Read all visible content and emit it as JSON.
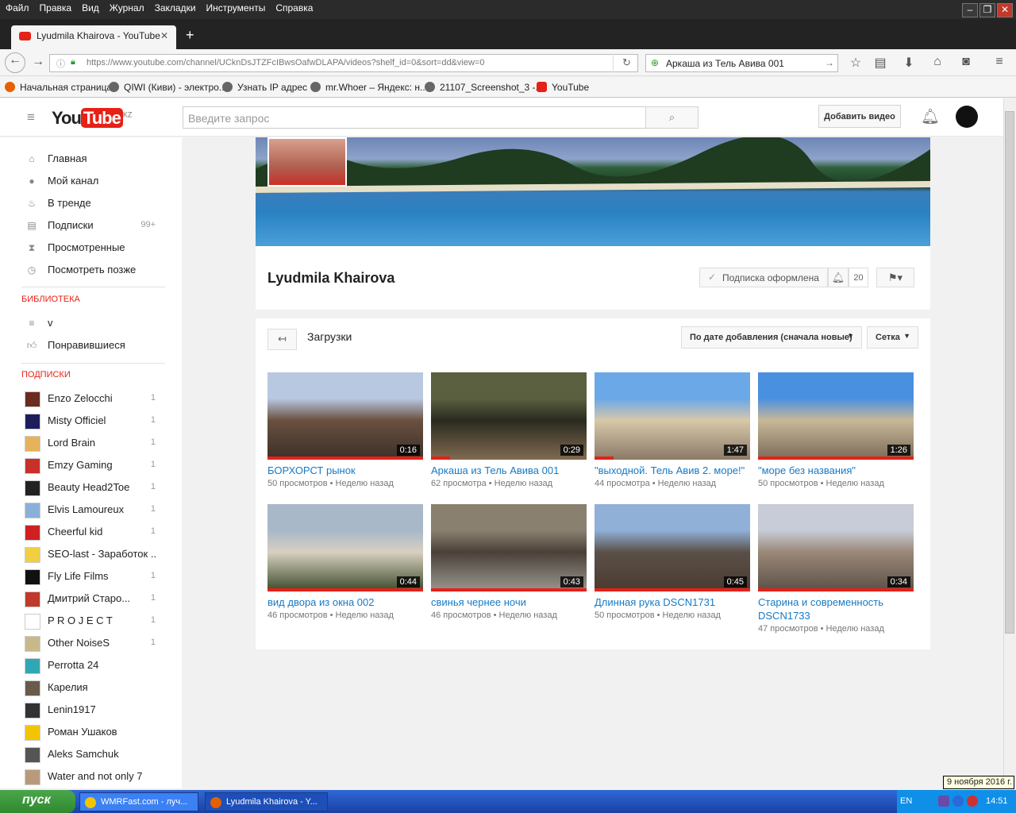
{
  "browser": {
    "menu": [
      "Файл",
      "Правка",
      "Вид",
      "Журнал",
      "Закладки",
      "Инструменты",
      "Справка"
    ],
    "tab_title": "Lyudmila Khairova - YouTube",
    "url": "https://www.youtube.com/channel/UCknDsJTZFcIBwsOafwDLAPA/videos?shelf_id=0&sort=dd&view=0",
    "search_value": "Аркаша из Тель Авива 001",
    "bookmarks": [
      "Начальная страница",
      "QIWI (Киви) - электро...",
      "Узнать IP адрес",
      "mr.Whoer – Яндекс: н...",
      "21107_Screenshot_3 -...",
      "YouTube"
    ]
  },
  "youtube": {
    "logo_you": "You",
    "logo_tube": "Tube",
    "logo_region": "KZ",
    "search_placeholder": "Введите запрос",
    "add_video": "Добавить видео"
  },
  "sidebar": {
    "nav": [
      {
        "icon": "home-icon",
        "label": "Главная"
      },
      {
        "icon": "user-icon",
        "label": "Мой канал"
      },
      {
        "icon": "flame-icon",
        "label": "В тренде"
      },
      {
        "icon": "subscriptions-icon",
        "label": "Подписки",
        "count": "99+"
      },
      {
        "icon": "hourglass-icon",
        "label": "Просмотренные"
      },
      {
        "icon": "clock-icon",
        "label": "Посмотреть позже"
      }
    ],
    "library_title": "БИБЛИОТЕКА",
    "library": [
      {
        "icon": "list-icon",
        "label": "v"
      },
      {
        "icon": "thumbs-up-icon",
        "label": "Понравившиеся"
      }
    ],
    "subs_title": "ПОДПИСКИ",
    "subscriptions": [
      {
        "label": "Enzo Zelocchi",
        "count": "1",
        "color": "#6b2b1e"
      },
      {
        "label": "Misty Officiel",
        "count": "1",
        "color": "#1d1d5e"
      },
      {
        "label": "Lord Brain",
        "count": "1",
        "color": "#e4b35a"
      },
      {
        "label": "Emzy Gaming",
        "count": "1",
        "color": "#c8302a"
      },
      {
        "label": "Beauty Head2Toe",
        "count": "1",
        "color": "#222222"
      },
      {
        "label": "Elvis Lamoureux",
        "count": "1",
        "color": "#8ab0d8"
      },
      {
        "label": "Cheerful kid",
        "count": "1",
        "color": "#d02020"
      },
      {
        "label": "SEO-last - Заработок ...",
        "count": "",
        "color": "#f0d040"
      },
      {
        "label": "Fly Life Films",
        "count": "1",
        "color": "#111111"
      },
      {
        "label": "Дмитрий Старо...",
        "count": "1",
        "color": "#c0392b"
      },
      {
        "label": "P R O J E C T",
        "count": "1",
        "color": "#ffffff"
      },
      {
        "label": "Other NoiseS",
        "count": "1",
        "color": "#c9b98a"
      },
      {
        "label": "Perrotta 24",
        "count": "",
        "color": "#2fa8b5"
      },
      {
        "label": "Карелия",
        "count": "",
        "color": "#6a5a4a"
      },
      {
        "label": "Lenin1917",
        "count": "",
        "color": "#333333"
      },
      {
        "label": "Роман Ушаков",
        "count": "",
        "color": "#f2c500"
      },
      {
        "label": "Aleks Samchuk",
        "count": "",
        "color": "#555555"
      },
      {
        "label": "Water and not only 7",
        "count": "",
        "color": "#b89a7a"
      }
    ]
  },
  "channel": {
    "name": "Lyudmila Khairova",
    "subscribed_label": "Подписка оформлена",
    "subscriber_count": "20"
  },
  "uploads": {
    "title": "Загрузки",
    "sort_label": "По дате добавления (сначала новые)",
    "view_label": "Сетка",
    "videos": [
      {
        "title": "БОРХОРСТ рынок",
        "duration": "0:16",
        "views": "50 просмотров",
        "age": "Неделю назад",
        "progress": 1.0,
        "colors": [
          "#b8c8e0",
          "#6a5040",
          "#3a3028"
        ]
      },
      {
        "title": "Аркаша из Тель Авива 001",
        "duration": "0:29",
        "views": "62 просмотра",
        "age": "Неделю назад",
        "progress": 0.12,
        "colors": [
          "#5a6040",
          "#2a2a20",
          "#806a50"
        ]
      },
      {
        "title": "\"выходной. Тель Авив 2. море!\"",
        "duration": "1:47",
        "views": "44 просмотра",
        "age": "Неделю назад",
        "progress": 0.12,
        "colors": [
          "#6aa8e8",
          "#d8c8a8",
          "#8a7a68"
        ]
      },
      {
        "title": "\"море без названия\"",
        "duration": "1:26",
        "views": "50 просмотров",
        "age": "Неделю назад",
        "progress": 1.0,
        "colors": [
          "#4a90e0",
          "#c8b898",
          "#7a6a58"
        ]
      },
      {
        "title": "вид двора из окна 002",
        "duration": "0:44",
        "views": "46 просмотров",
        "age": "Неделю назад",
        "progress": 1.0,
        "colors": [
          "#a8b8c8",
          "#d8d0c0",
          "#3a4a2a"
        ]
      },
      {
        "title": "свинья чернее ночи",
        "duration": "0:43",
        "views": "46 просмотров",
        "age": "Неделю назад",
        "progress": 1.0,
        "colors": [
          "#8a8070",
          "#4a4038",
          "#9a9890"
        ]
      },
      {
        "title": "Длинная рука DSCN1731",
        "duration": "0:45",
        "views": "50 просмотров",
        "age": "Неделю назад",
        "progress": 1.0,
        "colors": [
          "#90b0d8",
          "#5a5048",
          "#4a3a30"
        ]
      },
      {
        "title": "Старина и современность DSCN1733",
        "duration": "0:34",
        "views": "47 просмотров",
        "age": "Неделю назад",
        "progress": 1.0,
        "colors": [
          "#c8ccd8",
          "#9a8878",
          "#5a5048"
        ]
      }
    ]
  },
  "taskbar": {
    "start": "пуск",
    "tasks": [
      "WMRFast.com - луч...",
      "Lyudmila Khairova - Y..."
    ],
    "lang": "EN",
    "time": "14:51",
    "date_tooltip": "9 ноября 2016 г."
  }
}
